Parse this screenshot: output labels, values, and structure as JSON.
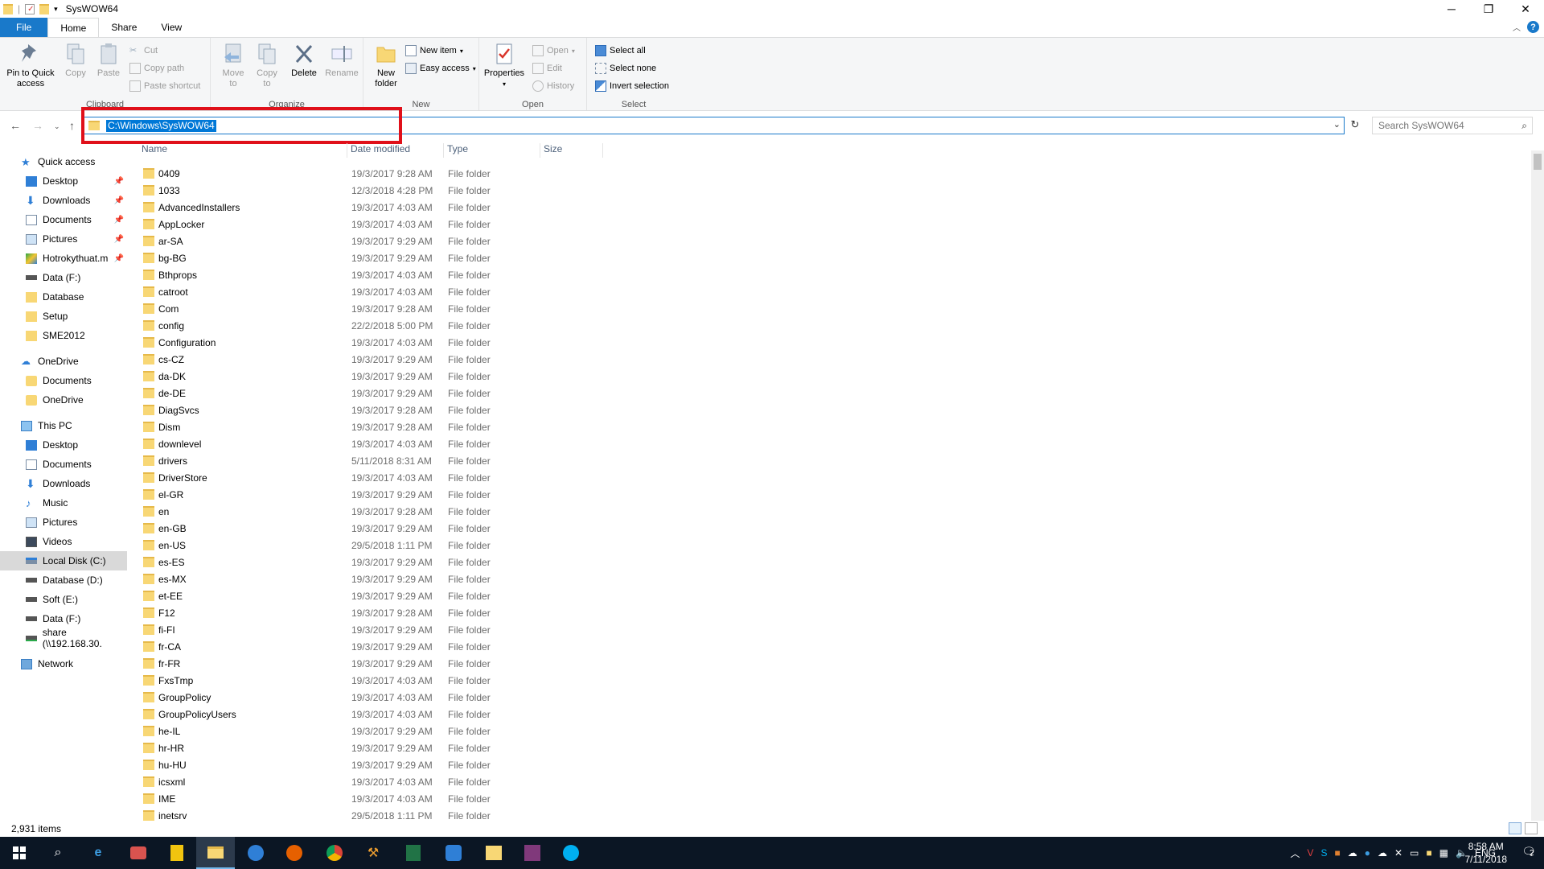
{
  "window": {
    "title": "SysWOW64",
    "minimize": "─",
    "maximize": "❐",
    "close": "✕"
  },
  "tabs": [
    "File",
    "Home",
    "Share",
    "View"
  ],
  "ribbon": {
    "clipboard": {
      "label": "Clipboard",
      "pin": "Pin to Quick access",
      "copy": "Copy",
      "paste": "Paste",
      "cut": "Cut",
      "copy_path": "Copy path",
      "paste_shortcut": "Paste shortcut"
    },
    "organize": {
      "label": "Organize",
      "move_to": "Move to",
      "copy_to": "Copy to",
      "delete": "Delete",
      "rename": "Rename"
    },
    "new": {
      "label": "New",
      "new_folder": "New folder",
      "new_item": "New item",
      "easy_access": "Easy access"
    },
    "open": {
      "label": "Open",
      "properties": "Properties",
      "open": "Open",
      "edit": "Edit",
      "history": "History"
    },
    "select": {
      "label": "Select",
      "select_all": "Select all",
      "select_none": "Select none",
      "invert": "Invert selection"
    }
  },
  "address": {
    "path": "C:\\Windows\\SysWOW64",
    "search_placeholder": "Search SysWOW64"
  },
  "nav": {
    "quick_access": "Quick access",
    "quick_items": [
      "Desktop",
      "Downloads",
      "Documents",
      "Pictures",
      "Hotrokythuat.m",
      "Data (F:)",
      "Database",
      "Setup",
      "SME2012"
    ],
    "onedrive": "OneDrive",
    "onedrive_items": [
      "Documents",
      "OneDrive"
    ],
    "this_pc": "This PC",
    "pc_items": [
      "Desktop",
      "Documents",
      "Downloads",
      "Music",
      "Pictures",
      "Videos",
      "Local Disk (C:)",
      "Database (D:)",
      "Soft (E:)",
      "Data (F:)",
      "share (\\\\192.168.30."
    ],
    "network": "Network"
  },
  "columns": {
    "name": "Name",
    "date": "Date modified",
    "type": "Type",
    "size": "Size"
  },
  "files": [
    {
      "name": "0409",
      "date": "19/3/2017 9:28 AM",
      "type": "File folder"
    },
    {
      "name": "1033",
      "date": "12/3/2018 4:28 PM",
      "type": "File folder"
    },
    {
      "name": "AdvancedInstallers",
      "date": "19/3/2017 4:03 AM",
      "type": "File folder"
    },
    {
      "name": "AppLocker",
      "date": "19/3/2017 4:03 AM",
      "type": "File folder"
    },
    {
      "name": "ar-SA",
      "date": "19/3/2017 9:29 AM",
      "type": "File folder"
    },
    {
      "name": "bg-BG",
      "date": "19/3/2017 9:29 AM",
      "type": "File folder"
    },
    {
      "name": "Bthprops",
      "date": "19/3/2017 4:03 AM",
      "type": "File folder"
    },
    {
      "name": "catroot",
      "date": "19/3/2017 4:03 AM",
      "type": "File folder"
    },
    {
      "name": "Com",
      "date": "19/3/2017 9:28 AM",
      "type": "File folder"
    },
    {
      "name": "config",
      "date": "22/2/2018 5:00 PM",
      "type": "File folder"
    },
    {
      "name": "Configuration",
      "date": "19/3/2017 4:03 AM",
      "type": "File folder"
    },
    {
      "name": "cs-CZ",
      "date": "19/3/2017 9:29 AM",
      "type": "File folder"
    },
    {
      "name": "da-DK",
      "date": "19/3/2017 9:29 AM",
      "type": "File folder"
    },
    {
      "name": "de-DE",
      "date": "19/3/2017 9:29 AM",
      "type": "File folder"
    },
    {
      "name": "DiagSvcs",
      "date": "19/3/2017 9:28 AM",
      "type": "File folder"
    },
    {
      "name": "Dism",
      "date": "19/3/2017 9:28 AM",
      "type": "File folder"
    },
    {
      "name": "downlevel",
      "date": "19/3/2017 4:03 AM",
      "type": "File folder"
    },
    {
      "name": "drivers",
      "date": "5/11/2018 8:31 AM",
      "type": "File folder"
    },
    {
      "name": "DriverStore",
      "date": "19/3/2017 4:03 AM",
      "type": "File folder"
    },
    {
      "name": "el-GR",
      "date": "19/3/2017 9:29 AM",
      "type": "File folder"
    },
    {
      "name": "en",
      "date": "19/3/2017 9:28 AM",
      "type": "File folder"
    },
    {
      "name": "en-GB",
      "date": "19/3/2017 9:29 AM",
      "type": "File folder"
    },
    {
      "name": "en-US",
      "date": "29/5/2018 1:11 PM",
      "type": "File folder"
    },
    {
      "name": "es-ES",
      "date": "19/3/2017 9:29 AM",
      "type": "File folder"
    },
    {
      "name": "es-MX",
      "date": "19/3/2017 9:29 AM",
      "type": "File folder"
    },
    {
      "name": "et-EE",
      "date": "19/3/2017 9:29 AM",
      "type": "File folder"
    },
    {
      "name": "F12",
      "date": "19/3/2017 9:28 AM",
      "type": "File folder"
    },
    {
      "name": "fi-FI",
      "date": "19/3/2017 9:29 AM",
      "type": "File folder"
    },
    {
      "name": "fr-CA",
      "date": "19/3/2017 9:29 AM",
      "type": "File folder"
    },
    {
      "name": "fr-FR",
      "date": "19/3/2017 9:29 AM",
      "type": "File folder"
    },
    {
      "name": "FxsTmp",
      "date": "19/3/2017 4:03 AM",
      "type": "File folder"
    },
    {
      "name": "GroupPolicy",
      "date": "19/3/2017 4:03 AM",
      "type": "File folder"
    },
    {
      "name": "GroupPolicyUsers",
      "date": "19/3/2017 4:03 AM",
      "type": "File folder"
    },
    {
      "name": "he-IL",
      "date": "19/3/2017 9:29 AM",
      "type": "File folder"
    },
    {
      "name": "hr-HR",
      "date": "19/3/2017 9:29 AM",
      "type": "File folder"
    },
    {
      "name": "hu-HU",
      "date": "19/3/2017 9:29 AM",
      "type": "File folder"
    },
    {
      "name": "icsxml",
      "date": "19/3/2017 4:03 AM",
      "type": "File folder"
    },
    {
      "name": "IME",
      "date": "19/3/2017 4:03 AM",
      "type": "File folder"
    },
    {
      "name": "inetsrv",
      "date": "29/5/2018 1:11 PM",
      "type": "File folder"
    }
  ],
  "status": {
    "count": "2,931 items"
  },
  "taskbar": {
    "tray_lang": "ENG",
    "time": "8:58 AM",
    "date": "7/11/2018",
    "notification_count": "2"
  }
}
